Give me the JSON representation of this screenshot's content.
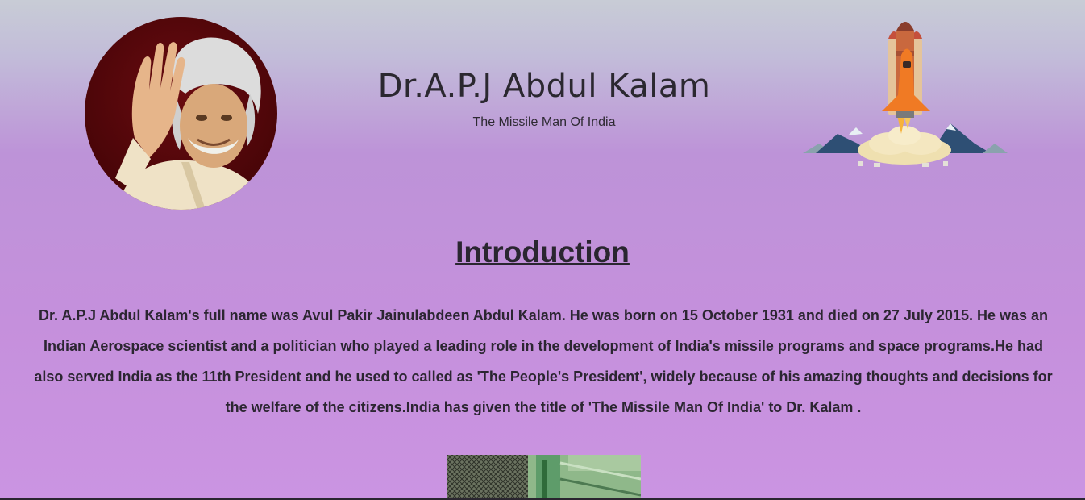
{
  "header": {
    "title": "Dr.A.P.J Abdul Kalam",
    "subtitle": "The Missile Man Of India"
  },
  "images": {
    "portrait_icon": "kalam-portrait",
    "rocket_icon": "rocket-launch-illustration",
    "bottom_icon": "kalam-photo"
  },
  "introduction": {
    "heading": "Introduction",
    "text": "Dr. A.P.J Abdul Kalam's full name was Avul Pakir Jainulabdeen Abdul Kalam. He was born on 15 October 1931 and died on 27 July 2015. He was an Indian Aerospace scientist and a politician who played a leading role in the development of India's missile programs and space programs.He had also served India as the 11th President and he used to called as 'The People's President', widely because of his amazing thoughts and decisions for the welfare of the citizens.India has given the title of 'The Missile Man Of India' to Dr. Kalam ."
  },
  "colors": {
    "background_top": "#c8ccd6",
    "background_main": "#c590dc",
    "text": "#2a2630"
  }
}
